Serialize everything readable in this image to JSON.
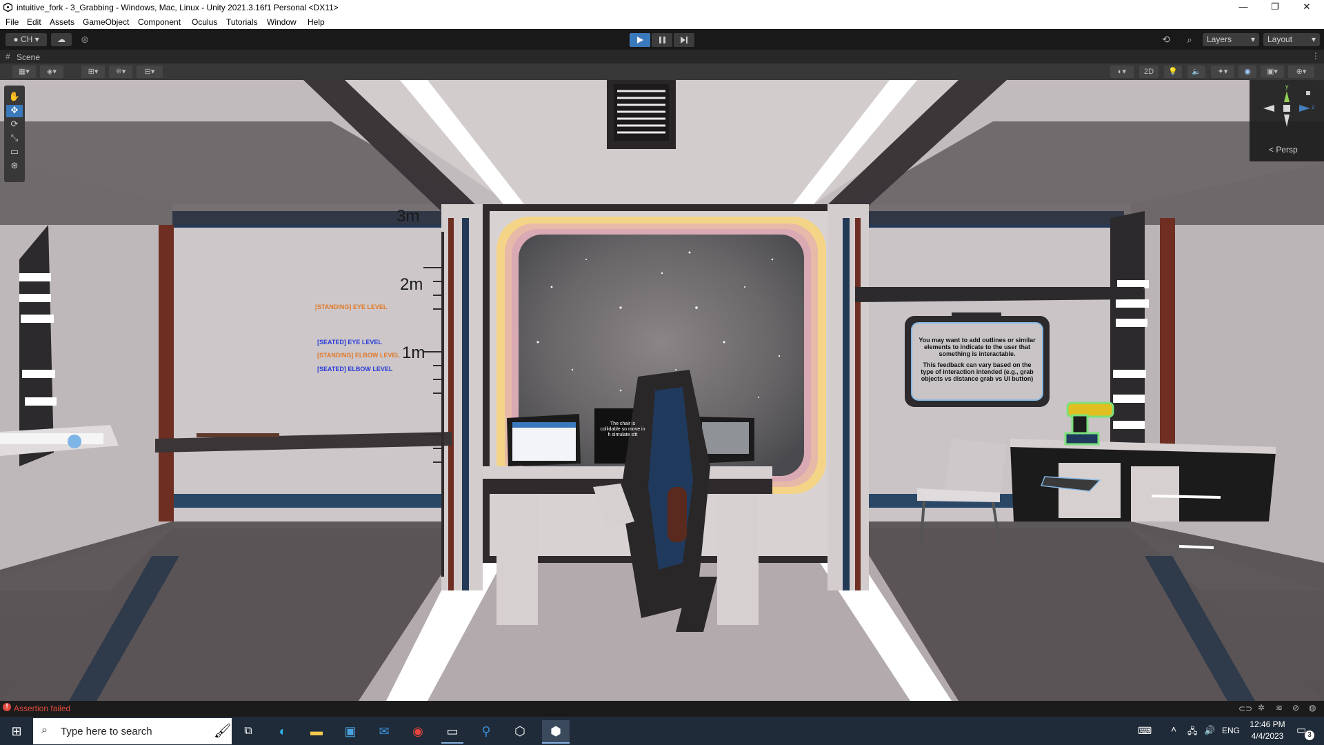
{
  "window": {
    "title": "intuitive_fork - 3_Grabbing - Windows, Mac, Linux - Unity 2021.3.16f1 Personal <DX11>",
    "controls": [
      "—",
      "❐",
      "✕"
    ]
  },
  "menu": [
    "File",
    "Edit",
    "Assets",
    "GameObject",
    "Component",
    "Oculus",
    "Tutorials",
    "Window",
    "Help"
  ],
  "toolbar": {
    "account": "CH",
    "layers_label": "Layers",
    "layout_label": "Layout"
  },
  "scene_tab": {
    "label": "Scene"
  },
  "scene_toolbar": {
    "mode_2d": "2D"
  },
  "gizmo": {
    "y": "y",
    "z": "z",
    "persp": "Persp"
  },
  "scene": {
    "height_3m": "3m",
    "height_2m": "2m",
    "height_1m": "1m",
    "standing_eye": "[STANDING] EYE LEVEL",
    "seated_eye": "[SEATED] EYE LEVEL",
    "standing_elbow": "[STANDING] ELBOW LEVEL",
    "seated_elbow": "[SEATED] ELBOW LEVEL",
    "sign_para1": "You may want to add outlines or similar elements to indicate to the user that something is interactable.",
    "sign_para2": "This feedback can vary based on the type of interaction intended (e.g., grab objects vs distance grab vs UI button)",
    "monitor_text": "The chair is collidable so move in h simulate sitt"
  },
  "status": {
    "message": "Assertion failed"
  },
  "taskbar": {
    "search_placeholder": "Type here to search",
    "lang": "ENG",
    "time": "12:46 PM",
    "date": "4/4/2023",
    "notifications": "3"
  },
  "colors": {
    "titlebar": "#ffffff",
    "editor_dark": "#191919",
    "play_active": "#3a79bb",
    "status_error": "#e04a3e",
    "taskbar": "#1f2b38"
  }
}
